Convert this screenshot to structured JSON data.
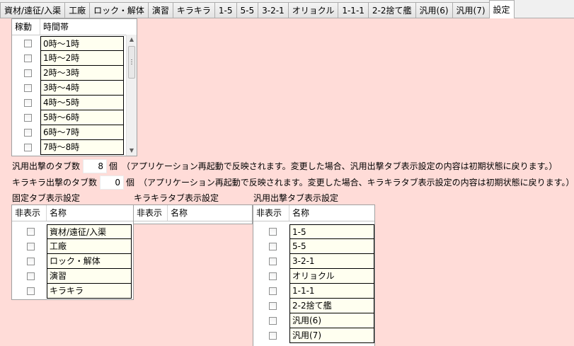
{
  "tabs": [
    {
      "label": "資材/遠征/入渠",
      "active": false
    },
    {
      "label": "工廠",
      "active": false
    },
    {
      "label": "ロック・解体",
      "active": false
    },
    {
      "label": "演習",
      "active": false
    },
    {
      "label": "キラキラ",
      "active": false
    },
    {
      "label": "1-5",
      "active": false
    },
    {
      "label": "5-5",
      "active": false
    },
    {
      "label": "3-2-1",
      "active": false
    },
    {
      "label": "オリョクル",
      "active": false
    },
    {
      "label": "1-1-1",
      "active": false
    },
    {
      "label": "2-2捨て艦",
      "active": false
    },
    {
      "label": "汎用(6)",
      "active": false
    },
    {
      "label": "汎用(7)",
      "active": false
    },
    {
      "label": "設定",
      "active": true
    }
  ],
  "schedule": {
    "col_active": "稼動",
    "col_time": "時間帯",
    "rows": [
      "0時～1時",
      "1時～2時",
      "2時～3時",
      "3時～4時",
      "4時～5時",
      "5時～6時",
      "6時～7時",
      "7時～8時"
    ]
  },
  "generic_tabs": {
    "label": "汎用出撃のタブ数",
    "value": "8",
    "unit": "個",
    "note": "（アプリケーション再起動で反映されます。変更した場合、汎用出撃タブ表示設定の内容は初期状態に戻ります。）"
  },
  "kira_tabs": {
    "label": "キラキラ出撃のタブ数",
    "value": "0",
    "unit": "個",
    "note": "（アプリケーション再起動で反映されます。変更した場合、キラキラタブ表示設定の内容は初期状態に戻ります。）"
  },
  "fixed_tab_display": {
    "title": "固定タブ表示設定",
    "col_hide": "非表示",
    "col_name": "名称",
    "rows": [
      "資材/遠征/入渠",
      "工廠",
      "ロック・解体",
      "演習",
      "キラキラ"
    ]
  },
  "kira_tab_display": {
    "title": "キラキラタブ表示設定",
    "col_hide": "非表示",
    "col_name": "名称"
  },
  "generic_tab_display": {
    "title": "汎用出撃タブ表示設定",
    "col_hide": "非表示",
    "col_name": "名称",
    "rows": [
      "1-5",
      "5-5",
      "3-2-1",
      "オリョクル",
      "1-1-1",
      "2-2捨て艦",
      "汎用(6)",
      "汎用(7)"
    ]
  }
}
